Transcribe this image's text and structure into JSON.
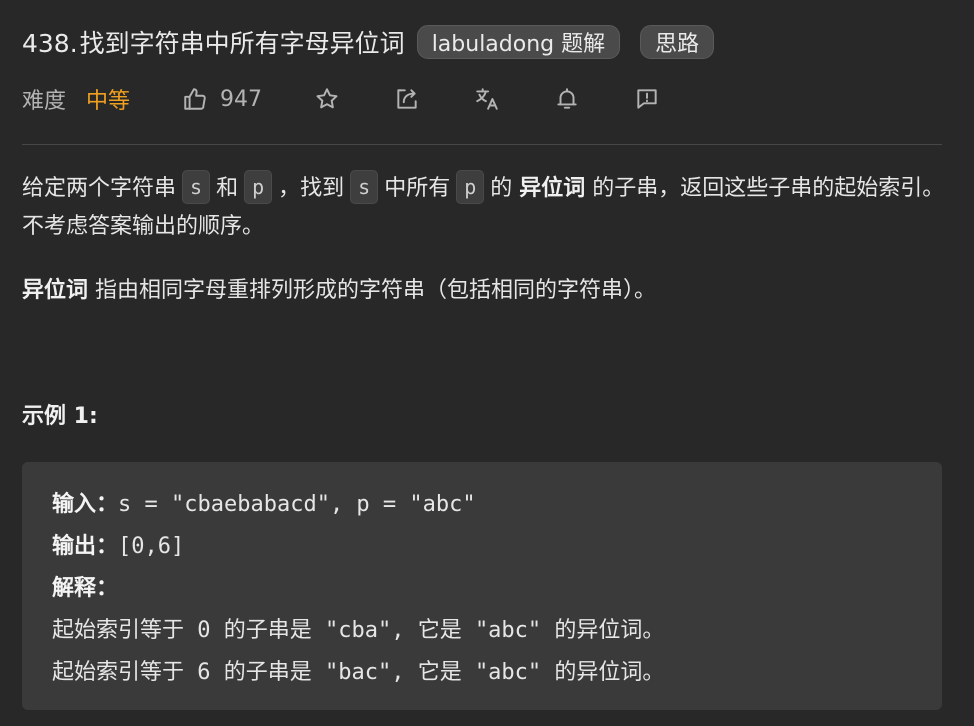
{
  "header": {
    "number": "438.",
    "title": "找到字符串中所有字母异位词",
    "tag_solution": "labuladong 题解",
    "tag_idea": "思路"
  },
  "meta": {
    "difficulty_label": "难度",
    "difficulty_value": "中等",
    "likes": "947",
    "icons": [
      "thumbs-up-icon",
      "star-icon",
      "share-icon",
      "translate-icon",
      "bell-icon",
      "feedback-icon"
    ],
    "difficulty_color": "#f0a020"
  },
  "description": {
    "p1_a": "给定两个字符串",
    "code_s": "s",
    "p1_b": "和",
    "code_p": "p",
    "p1_c": "，找到",
    "p1_d": "中所有",
    "p1_e": "的",
    "p1_strong": "异位词",
    "p1_f": "的子串，返回这些子串的起始索引。不考虑答案输出的顺序。",
    "p2_strong": "异位词",
    "p2_text": "指由相同字母重排列形成的字符串（包括相同的字符串）。"
  },
  "example": {
    "title": "示例 1:",
    "input_label": "输入：",
    "input_value": "s = \"cbaebabacd\", p = \"abc\"",
    "output_label": "输出：",
    "output_value": "[0,6]",
    "explain_label": "解释：",
    "explain_1": "起始索引等于 0 的子串是 \"cba\", 它是 \"abc\" 的异位词。",
    "explain_2": "起始索引等于 6 的子串是 \"bac\", 它是 \"abc\" 的异位词。"
  }
}
